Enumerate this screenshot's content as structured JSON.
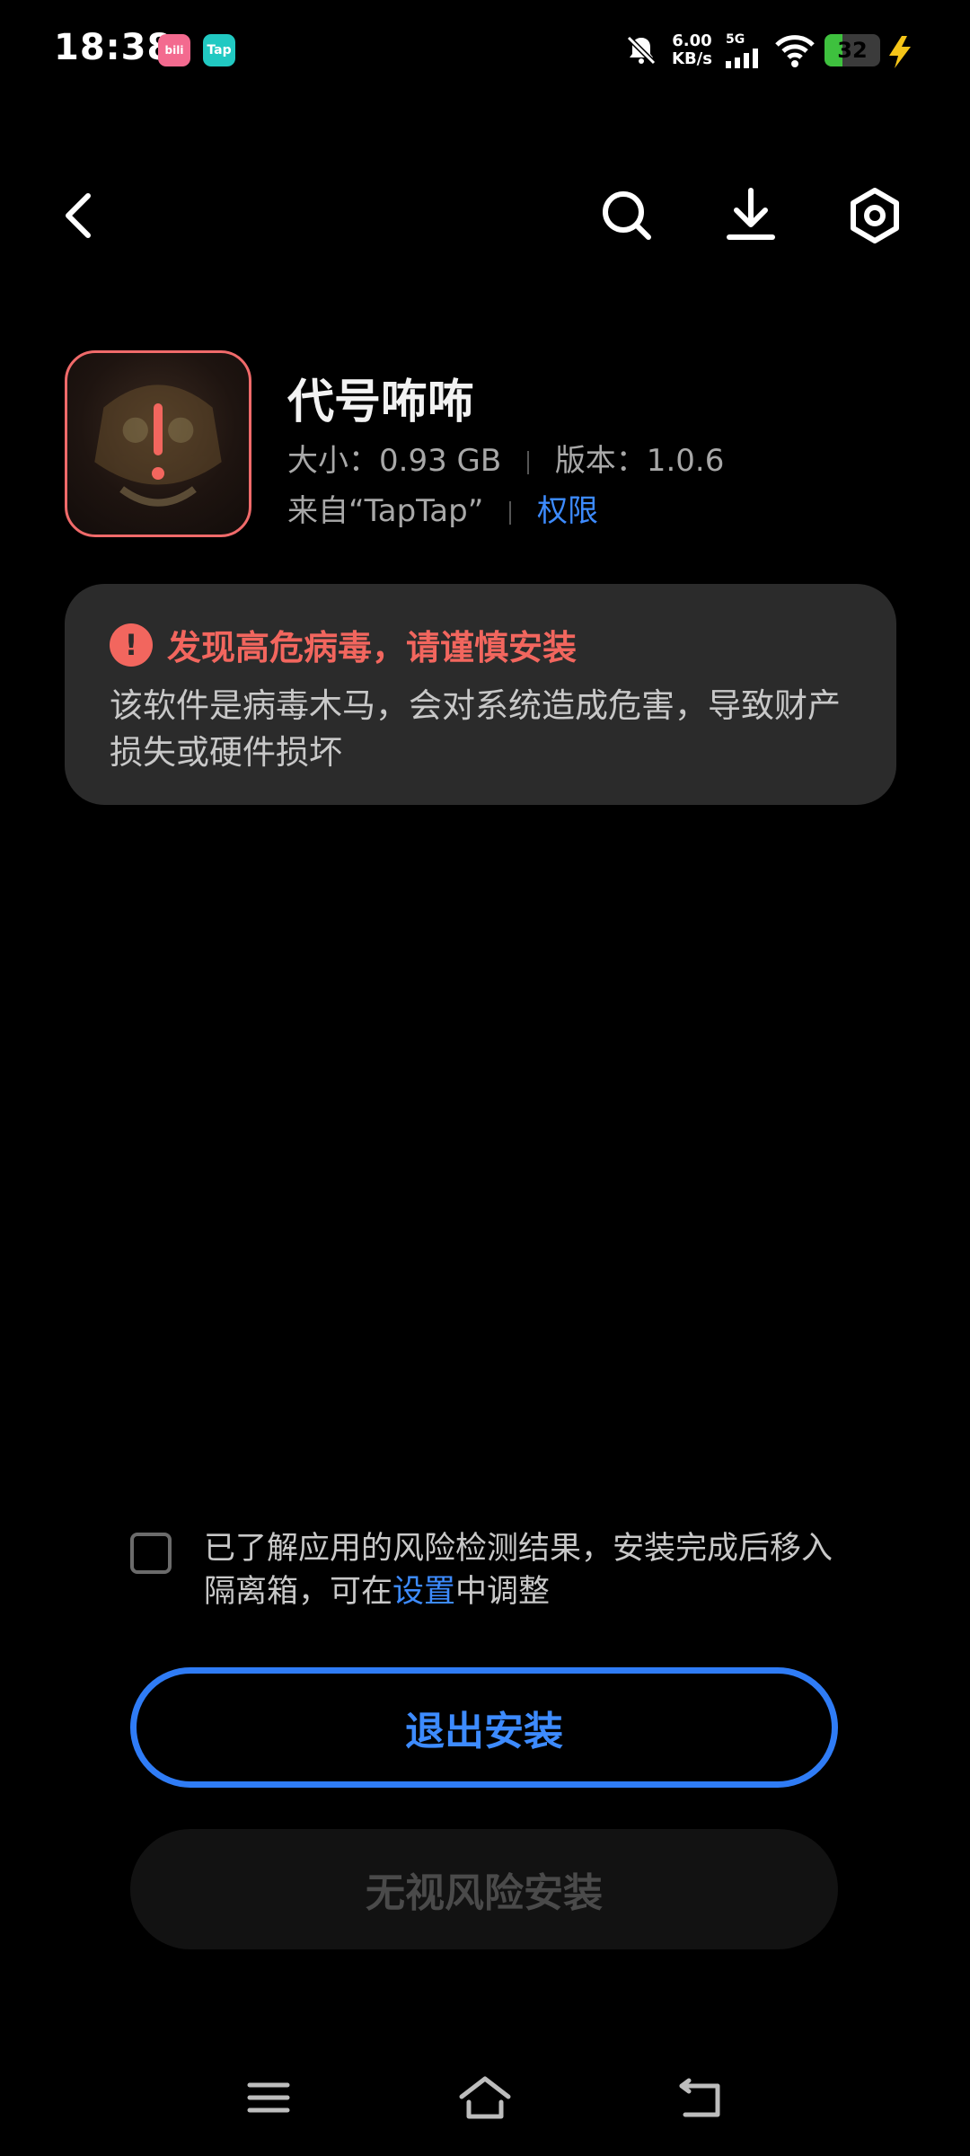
{
  "status_bar": {
    "time": "18:38",
    "app_badges": [
      "bilibili",
      "Tap"
    ],
    "net_speed_value": "6.00",
    "net_speed_unit": "KB/s",
    "network_type": "5G",
    "battery_level": 32,
    "battery_text": "32"
  },
  "toolbar": {
    "back_icon": "chevron-left-icon",
    "search_icon": "search-icon",
    "download_icon": "download-icon",
    "settings_icon": "settings-icon"
  },
  "app": {
    "name": "代号咘咘",
    "size": "大小：0.93 GB",
    "version": "版本：1.0.6",
    "source": "来自“TapTap”",
    "permissions_link": "权限"
  },
  "warning": {
    "title": "发现高危病毒，请谨慎安装",
    "description": "该软件是病毒木马，会对系统造成危害，导致财产损失或硬件损坏",
    "accent_color": "#f2665e"
  },
  "consent": {
    "checked": false,
    "text_before": "已了解应用的风险检测结果，安装完成后移入隔离箱，可在",
    "link": "设置",
    "text_after": "中调整"
  },
  "buttons": {
    "exit_install": "退出安装",
    "ignore_risk_install": "无视风险安装",
    "accent_color": "#2f7cf6"
  },
  "nav_bar": {
    "menu_icon": "menu-icon",
    "home_icon": "home-icon",
    "back_icon": "back-icon"
  }
}
